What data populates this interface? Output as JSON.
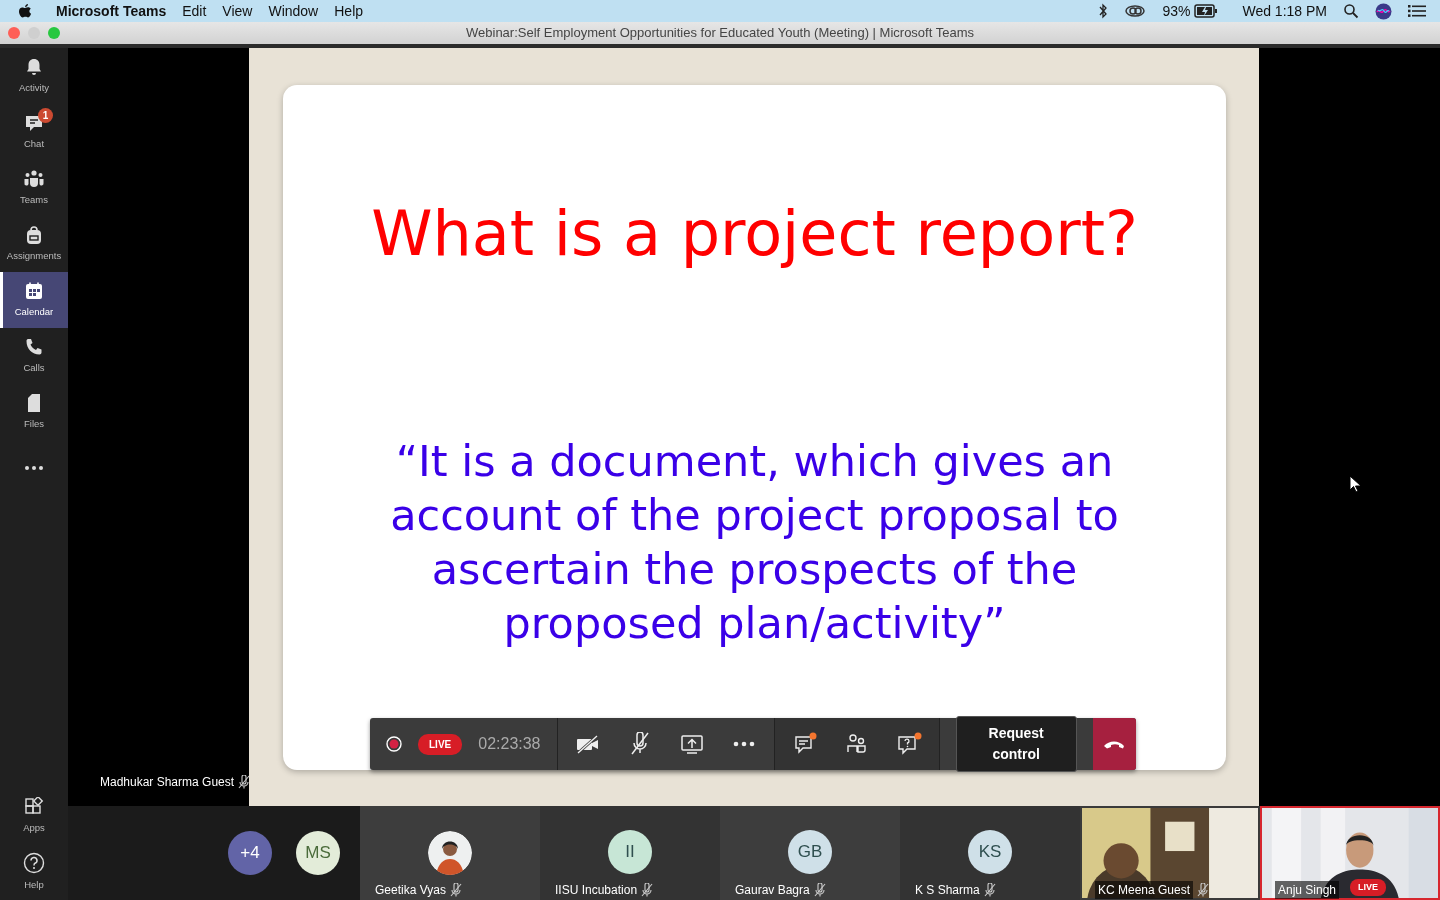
{
  "menu_bar": {
    "app": "Microsoft Teams",
    "menus": [
      "Edit",
      "View",
      "Window",
      "Help"
    ],
    "battery": "93%",
    "clock": "Wed 1:18 PM"
  },
  "window": {
    "title": "Webinar:Self Employment Opportunities for Educated Youth (Meeting) | Microsoft Teams"
  },
  "sidebar": {
    "items": [
      {
        "label": "Activity",
        "selected": false
      },
      {
        "label": "Chat",
        "selected": false,
        "badge": "1"
      },
      {
        "label": "Teams",
        "selected": false
      },
      {
        "label": "Assignments",
        "selected": false
      },
      {
        "label": "Calendar",
        "selected": true
      },
      {
        "label": "Calls",
        "selected": false
      },
      {
        "label": "Files",
        "selected": false
      }
    ],
    "bottom_items": [
      {
        "label": "Apps"
      },
      {
        "label": "Help"
      }
    ]
  },
  "slide": {
    "title": "What is a project report?",
    "quote": "“It is a document, which gives an account of the project proposal to ascertain the prospects of the proposed plan/activity”"
  },
  "presenter": {
    "name": "Madhukar Sharma Guest",
    "muted": true
  },
  "call_bar": {
    "recording": true,
    "live": "LIVE",
    "duration": "02:23:38",
    "camera_off": true,
    "mic_muted": true,
    "chat_unread": true,
    "qa_unread": true,
    "request_control": "Request control"
  },
  "overflow": [
    {
      "text": "+4",
      "color": "#6264a7"
    },
    {
      "text": "MS",
      "color": "#e3ecd9"
    }
  ],
  "participants": [
    {
      "name": "Geetika Vyas",
      "muted": true,
      "speaking": false
    },
    {
      "kind": "initials",
      "initials": "II",
      "color": "#c7e6d6",
      "name": "IISU Incubation",
      "muted": true,
      "speaking": false
    },
    {
      "kind": "initials",
      "initials": "GB",
      "color": "#cfe0e8",
      "name": "Gaurav Bagra",
      "muted": true,
      "speaking": false
    },
    {
      "kind": "initials",
      "initials": "KS",
      "color": "#cfe0e8",
      "name": "K S Sharma",
      "muted": true,
      "speaking": false
    },
    {
      "kind": "video",
      "name": "KC Meena Guest",
      "muted": true,
      "speaking": false
    },
    {
      "kind": "video",
      "name": "Anju Singh",
      "muted": false,
      "speaking": true,
      "live": "LIVE"
    }
  ]
}
